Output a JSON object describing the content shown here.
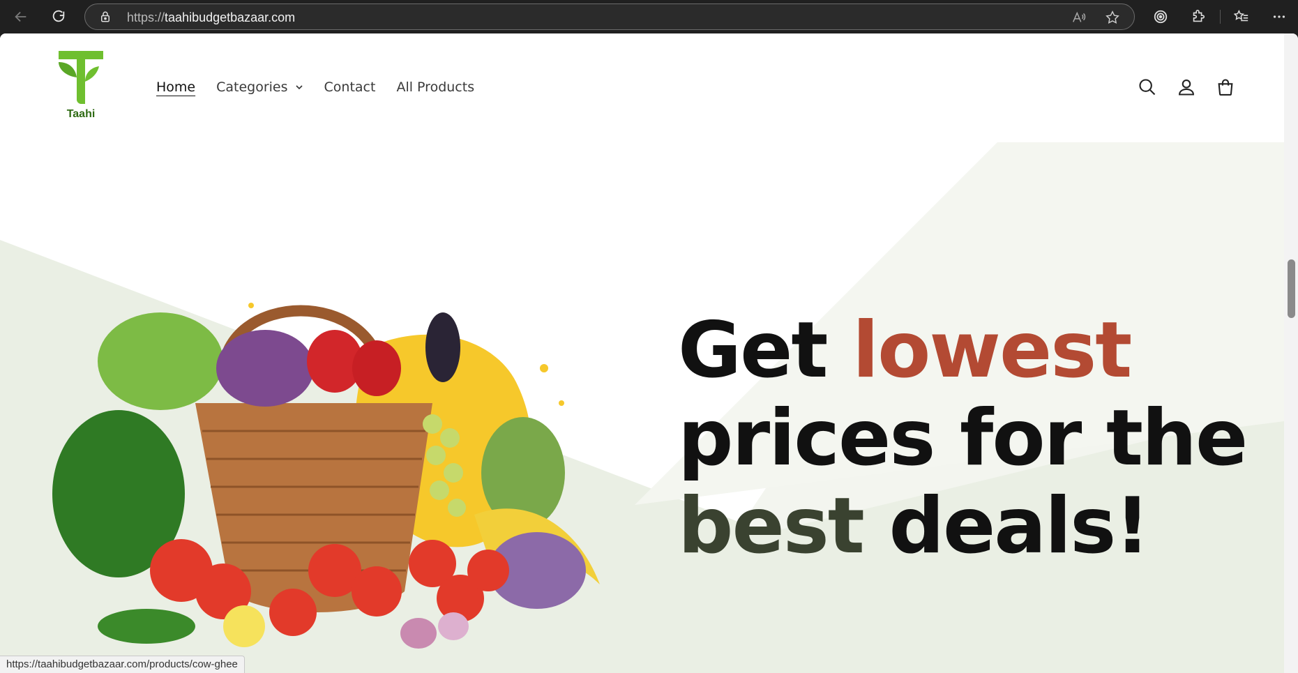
{
  "browser": {
    "url_protocol": "https://",
    "url_host": "taahibudgetbazaar.com"
  },
  "header": {
    "logo_text": "Taahi",
    "nav": [
      {
        "label": "Home",
        "active": true
      },
      {
        "label": "Categories",
        "dropdown": true
      },
      {
        "label": "Contact"
      },
      {
        "label": "All Products"
      }
    ],
    "icons": [
      "search-icon",
      "account-icon",
      "cart-icon"
    ]
  },
  "hero": {
    "line1_a": "Get",
    "line1_b": "lowest",
    "line2": "prices for the",
    "line3_a": "best",
    "line3_b": "deals!"
  },
  "status_bar": {
    "link": "https://taahibudgetbazaar.com/products/cow-ghee"
  },
  "colors": {
    "logo_green": "#6fbf2f",
    "accent_red": "#b34a33",
    "accent_olive": "#3a4230",
    "hero_bg": "#f4f6f0"
  }
}
